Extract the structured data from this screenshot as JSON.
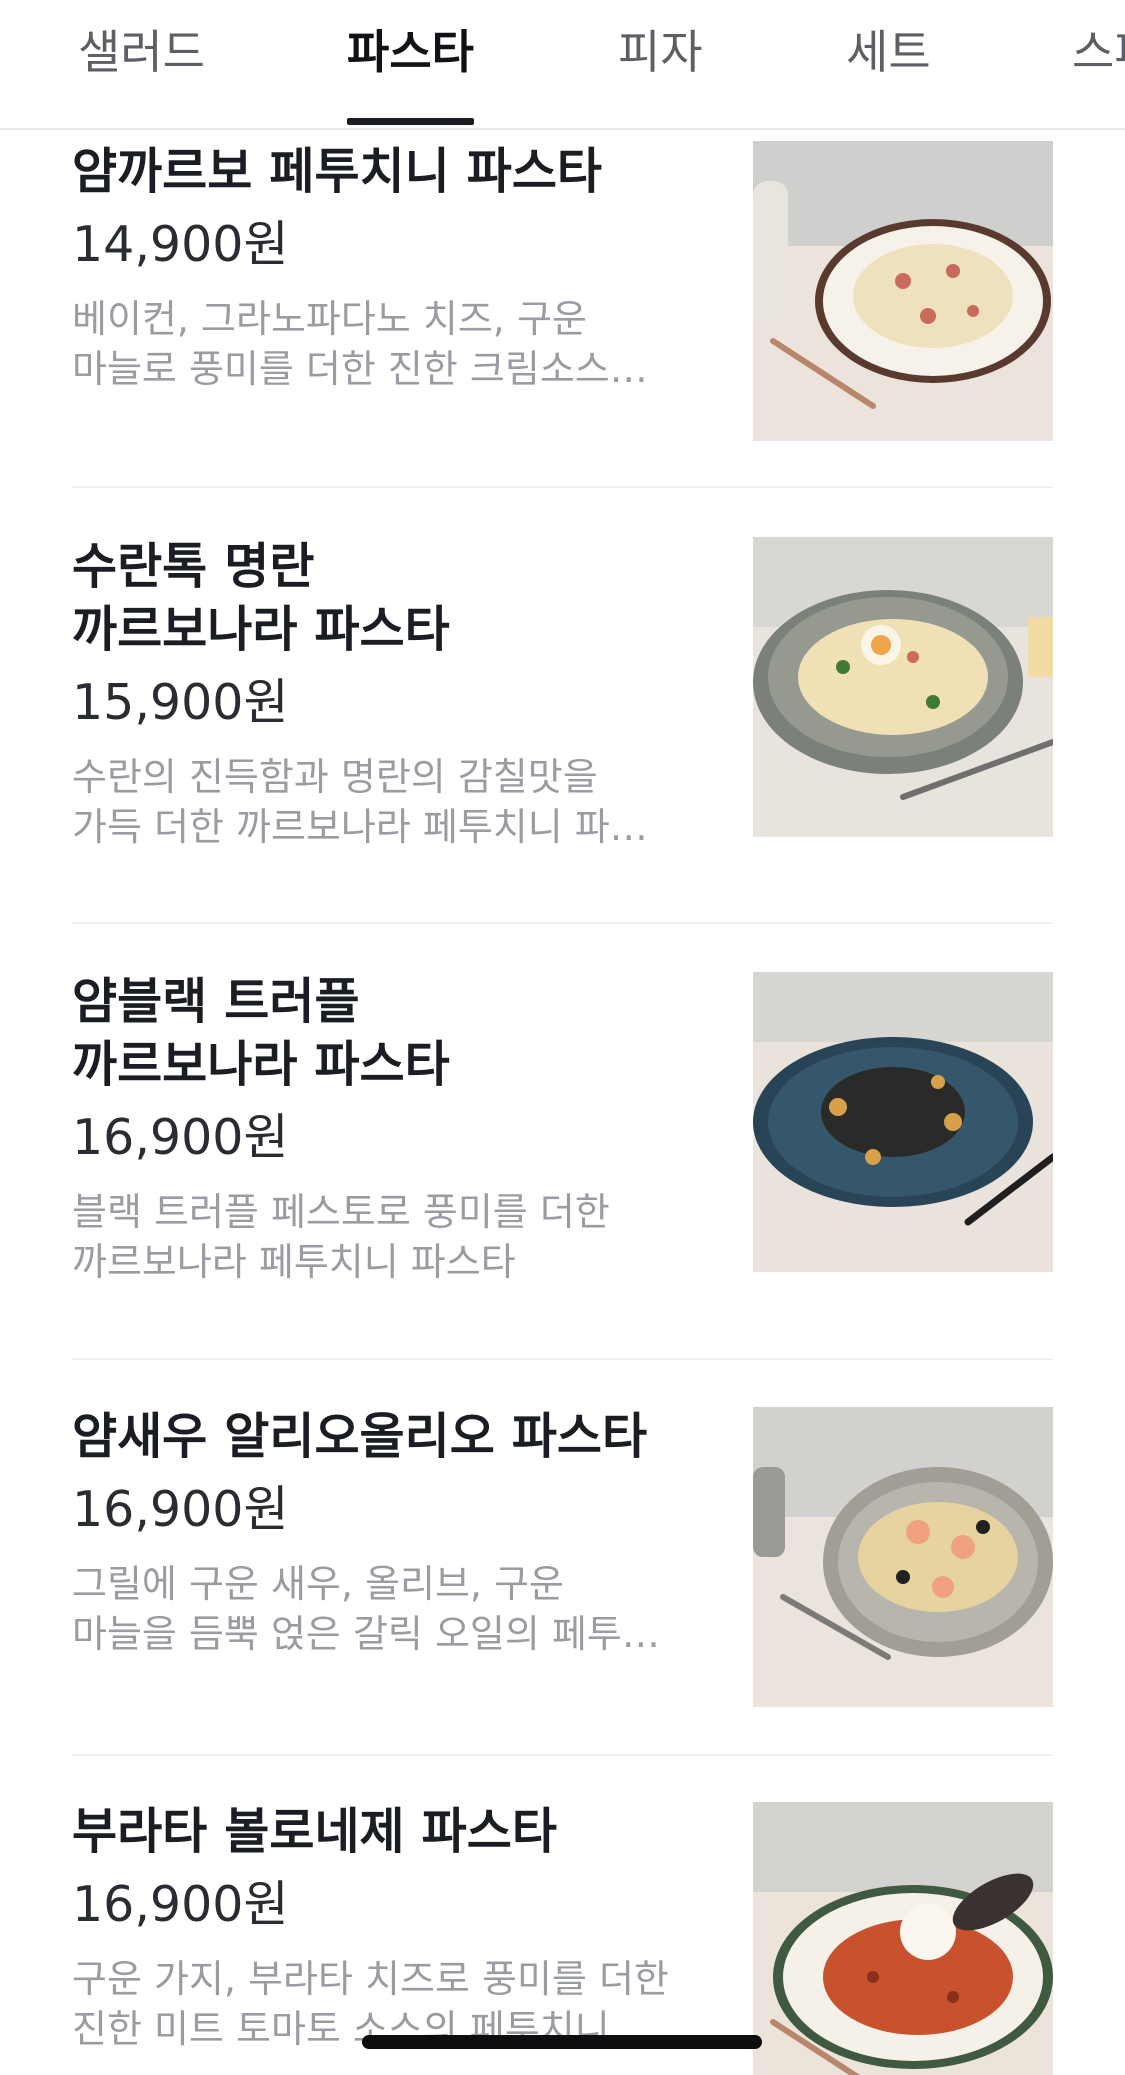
{
  "tabs": [
    {
      "label": "샐러드"
    },
    {
      "label": "파스타"
    },
    {
      "label": "피자"
    },
    {
      "label": "세트"
    },
    {
      "label": "스파"
    }
  ],
  "active_tab": "파스타",
  "items": [
    {
      "name": "얌까르보 페투치니 파스타",
      "price": "14,900원",
      "description": "베이컨, 그라노파다노 치즈, 구운\n마늘로 풍미를 더한 진한 크림소스…",
      "plate_color": "#f3efe8",
      "rim_color": "#5a3a2e",
      "food_color": "#efe1bd"
    },
    {
      "name": "수란톡 명란\n까르보나라 파스타",
      "price": "15,900원",
      "description": "수란의 진득함과 명란의 감칠맛을\n가득 더한 까르보나라 페투치니 파…",
      "plate_color": "#8e928a",
      "rim_color": "#6f736c",
      "food_color": "#efe0b6"
    },
    {
      "name": "얌블랙 트러플\n까르보나라 파스타",
      "price": "16,900원",
      "description": "블랙 트러플 페스토로 풍미를 더한\n까르보나라 페투치니 파스타",
      "plate_color": "#2f4f62",
      "rim_color": "#254050",
      "food_color": "#2a2a28"
    },
    {
      "name": "얌새우 알리오올리오 파스타",
      "price": "16,900원",
      "description": "그릴에 구운 새우, 올리브, 구운\n마늘을 듬뿍 얹은 갈릭 오일의 페투…",
      "plate_color": "#a7a49c",
      "rim_color": "#8d8a82",
      "food_color": "#e6d3a0"
    },
    {
      "name": "부라타 볼로네제 파스타",
      "price": "16,900원",
      "description": "구운 가지, 부라타 치즈로 풍미를 더한\n진한 미트 토마토 소스의 페투치니…",
      "plate_color": "#f3efe8",
      "rim_color": "#3f5a40",
      "food_color": "#c8522e"
    }
  ]
}
